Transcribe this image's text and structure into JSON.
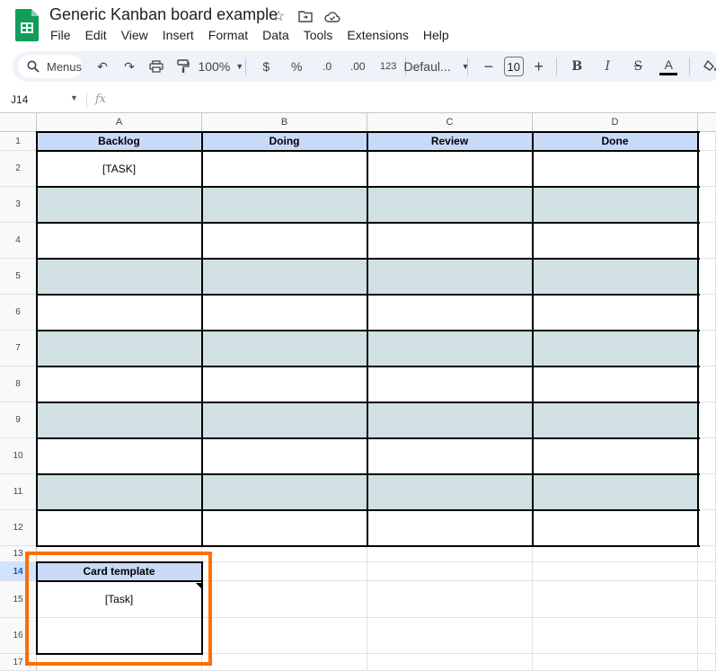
{
  "doc": {
    "title": "Generic Kanban board example"
  },
  "menu": [
    "File",
    "Edit",
    "View",
    "Insert",
    "Format",
    "Data",
    "Tools",
    "Extensions",
    "Help"
  ],
  "toolbar": {
    "search_label": "Menus",
    "zoom": "100%",
    "currency": "$",
    "percent": "%",
    "dec_decrease": ".0",
    "dec_increase": ".00",
    "number_format": "123",
    "font": "Defaul...",
    "font_size": "10"
  },
  "formula_bar": {
    "cell_ref": "J14",
    "fx": "fx",
    "value": ""
  },
  "columns": [
    "A",
    "B",
    "C",
    "D"
  ],
  "rows": [
    "1",
    "2",
    "3",
    "4",
    "5",
    "6",
    "7",
    "8",
    "9",
    "10",
    "11",
    "12",
    "13",
    "14",
    "15",
    "16",
    "17"
  ],
  "selected_row": "14",
  "board": {
    "headers": [
      "Backlog",
      "Doing",
      "Review",
      "Done"
    ],
    "first_task": "[TASK]"
  },
  "card_template": {
    "header": "Card template",
    "task": "[Task]"
  },
  "colors": {
    "header_fill": "#c9daf8",
    "band_fill": "#d0e0e3",
    "highlight": "#ff6d01",
    "sheets_green": "#0f9d58"
  }
}
